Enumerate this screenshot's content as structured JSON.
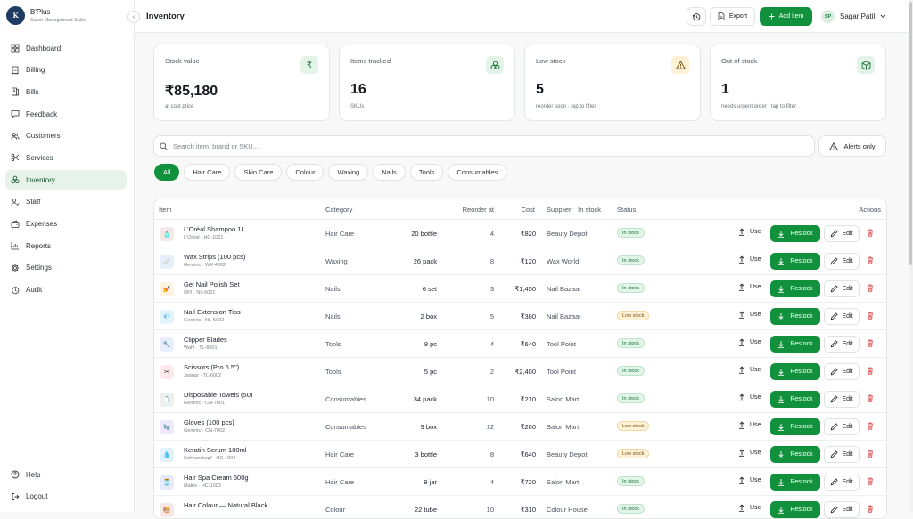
{
  "sidebar": {
    "brand_name": "B'Plus",
    "brand_sub": "Salon Management Suite",
    "logo_text": "K",
    "items": [
      {
        "label": "Dashboard",
        "icon": "grid-icon"
      },
      {
        "label": "Billing",
        "icon": "receipt-icon"
      },
      {
        "label": "Bills",
        "icon": "bills-icon"
      },
      {
        "label": "Feedback",
        "icon": "message-icon"
      },
      {
        "label": "Customers",
        "icon": "users-icon"
      },
      {
        "label": "Services",
        "icon": "scissors-icon"
      },
      {
        "label": "Inventory",
        "icon": "boxes-icon",
        "active": true
      },
      {
        "label": "Staff",
        "icon": "staff-icon"
      },
      {
        "label": "Expenses",
        "icon": "wallet-icon"
      },
      {
        "label": "Reports",
        "icon": "chart-icon"
      },
      {
        "label": "Settings",
        "icon": "gear-icon"
      },
      {
        "label": "Audit",
        "icon": "history-icon"
      }
    ],
    "help_label": "Help",
    "logout_label": "Logout"
  },
  "header": {
    "title": "Inventory",
    "export_label": "Export",
    "add_label": "Add item",
    "user_initials": "SP",
    "user_name": "Sagar Patil"
  },
  "cards": [
    {
      "label": "Stock value",
      "value": "₹85,180",
      "note": "at cost price",
      "icon": "rupee-icon",
      "icon_glyph": "₹",
      "tone": "green"
    },
    {
      "label": "Items tracked",
      "value": "16",
      "note": "SKUs",
      "icon": "boxes-icon",
      "icon_glyph": "",
      "tone": "green"
    },
    {
      "label": "Low stock",
      "value": "5",
      "note": "reorder soon · tap to filter",
      "icon": "warning-icon",
      "icon_glyph": "",
      "tone": "amber"
    },
    {
      "label": "Out of stock",
      "value": "1",
      "note": "needs urgent order · tap to filter",
      "icon": "package-icon",
      "icon_glyph": "",
      "tone": "green"
    }
  ],
  "search": {
    "placeholder": "Search item, brand or SKU..."
  },
  "alerts_label": "Alerts only",
  "filters": [
    "All",
    "Hair Care",
    "Skin Care",
    "Colour",
    "Waxing",
    "Nails",
    "Tools",
    "Consumables"
  ],
  "table": {
    "columns": [
      "Item",
      "Category",
      "In stock",
      "Reorder at",
      "Cost",
      "Supplier",
      "Status",
      "Actions"
    ],
    "use_label": "Use",
    "restock_label": "Restock",
    "edit_label": "Edit",
    "rows": [
      {
        "name": "L'Oréal Shampoo 1L",
        "meta": "L'Oréal · HC-1001",
        "category": "Hair Care",
        "stock": "20 bottle",
        "reorder": "4",
        "cost": "₹820",
        "supplier": "Beauty Depot",
        "status": "In stock",
        "thumb_color": "#f6e7e7",
        "thumb_glyph": "🧴"
      },
      {
        "name": "Wax Strips (100 pcs)",
        "meta": "Generic · WX-4002",
        "category": "Waxing",
        "stock": "26 pack",
        "reorder": "8",
        "cost": "₹120",
        "supplier": "Wax World",
        "status": "In stock",
        "thumb_color": "#e6f0fb",
        "thumb_glyph": "🩹"
      },
      {
        "name": "Gel Nail Polish Set",
        "meta": "OPI · NL-5001",
        "category": "Nails",
        "stock": "6 set",
        "reorder": "3",
        "cost": "₹1,450",
        "supplier": "Nail Bazaar",
        "status": "In stock",
        "thumb_color": "#fdf3e3",
        "thumb_glyph": "💅"
      },
      {
        "name": "Nail Extension Tips",
        "meta": "Generic · NL-5002",
        "category": "Nails",
        "stock": "2 box",
        "reorder": "5",
        "cost": "₹380",
        "supplier": "Nail Bazaar",
        "status": "Low stock",
        "thumb_color": "#e4f4fb",
        "thumb_glyph": "💎"
      },
      {
        "name": "Clipper Blades",
        "meta": "Wahl · TL-6001",
        "category": "Tools",
        "stock": "8 pc",
        "reorder": "4",
        "cost": "₹640",
        "supplier": "Tool Point",
        "status": "In stock",
        "thumb_color": "#e8eefb",
        "thumb_glyph": "🔧"
      },
      {
        "name": "Scissors (Pro 6.5\")",
        "meta": "Jaguar · TL-6002",
        "category": "Tools",
        "stock": "5 pc",
        "reorder": "2",
        "cost": "₹2,400",
        "supplier": "Tool Point",
        "status": "In stock",
        "thumb_color": "#fbe9ec",
        "thumb_glyph": "✂"
      },
      {
        "name": "Disposable Towels (50)",
        "meta": "Generic · CN-7001",
        "category": "Consumables",
        "stock": "34 pack",
        "reorder": "10",
        "cost": "₹210",
        "supplier": "Salon Mart",
        "status": "In stock",
        "thumb_color": "#eef0ee",
        "thumb_glyph": "🧻"
      },
      {
        "name": "Gloves (100 pcs)",
        "meta": "Generic · CN-7002",
        "category": "Consumables",
        "stock": "9 box",
        "reorder": "12",
        "cost": "₹260",
        "supplier": "Salon Mart",
        "status": "Low stock",
        "thumb_color": "#f1e8fa",
        "thumb_glyph": "🧤"
      },
      {
        "name": "Keratin Serum 100ml",
        "meta": "Schwarzkopf · HC-1002",
        "category": "Hair Care",
        "stock": "3 bottle",
        "reorder": "8",
        "cost": "₹640",
        "supplier": "Beauty Depot",
        "status": "Low stock",
        "thumb_color": "#e3f1fb",
        "thumb_glyph": "💧"
      },
      {
        "name": "Hair Spa Cream 500g",
        "meta": "Matrix · HC-1003",
        "category": "Hair Care",
        "stock": "9 jar",
        "reorder": "4",
        "cost": "₹720",
        "supplier": "Salon Mart",
        "status": "In stock",
        "thumb_color": "#e5ebfa",
        "thumb_glyph": "🫙"
      },
      {
        "name": "Hair Colour — Natural Black",
        "meta": "",
        "category": "Colour",
        "stock": "22 tube",
        "reorder": "10",
        "cost": "₹310",
        "supplier": "Colour House",
        "status": "In stock",
        "thumb_color": "#f7e6e6",
        "thumb_glyph": "🎨"
      }
    ]
  }
}
